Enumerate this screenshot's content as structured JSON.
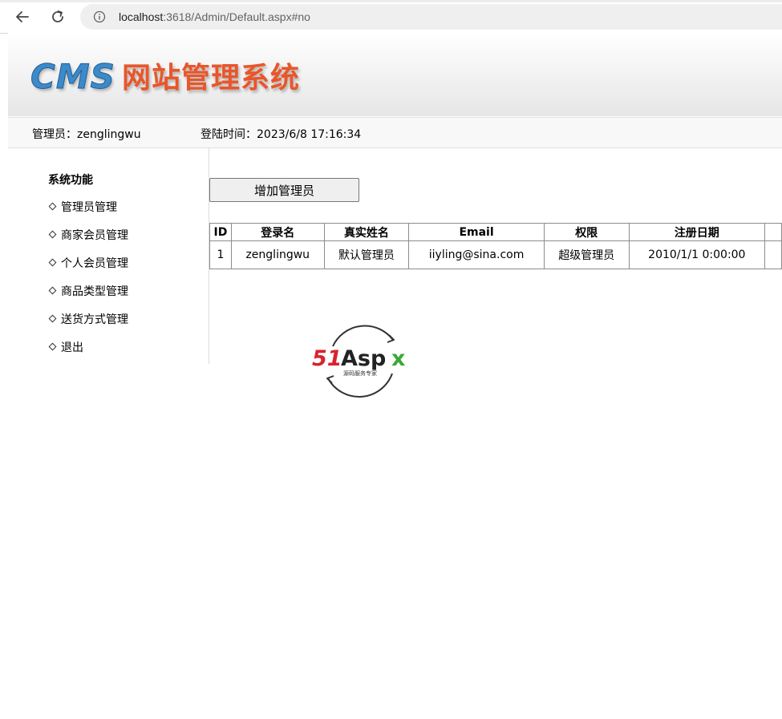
{
  "browser": {
    "url_host": "localhost",
    "url_rest": ":3618/Admin/Default.aspx#no"
  },
  "header": {
    "logo_cms": "CMS",
    "logo_title": "网站管理系统",
    "admin_label": "管理员：zenglingwu",
    "login_time": "登陆时间：2023/6/8 17:16:34"
  },
  "sidebar": {
    "title": "系统功能",
    "items": [
      {
        "label": "管理员管理"
      },
      {
        "label": "商家会员管理"
      },
      {
        "label": "个人会员管理"
      },
      {
        "label": "商品类型管理"
      },
      {
        "label": "送货方式管理"
      },
      {
        "label": "退出"
      }
    ]
  },
  "main": {
    "add_button": "增加管理员",
    "table": {
      "headers": [
        "ID",
        "登录名",
        "真实姓名",
        "Email",
        "权限",
        "注册日期"
      ],
      "rows": [
        [
          "1",
          "zenglingwu",
          "默认管理员",
          "iiyling@sina.com",
          "超级管理员",
          "2010/1/1 0:00:00"
        ]
      ]
    }
  },
  "watermark": {
    "brand": "51Aspx",
    "tagline": "源码服务专家"
  },
  "colors": {
    "logo_cms": "#3d8ac9",
    "logo_title": "#e8562a",
    "watermark_red": "#d9232e",
    "watermark_green": "#3aa935"
  }
}
